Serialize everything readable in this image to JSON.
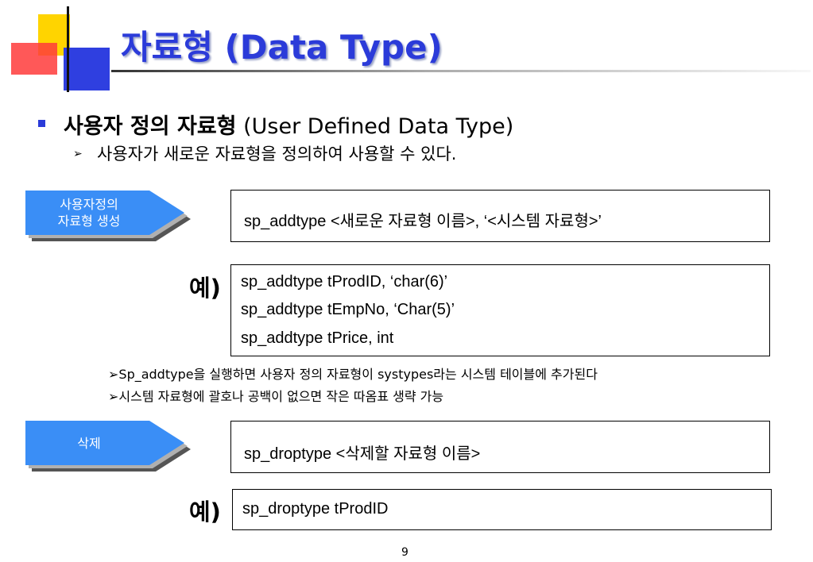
{
  "slide": {
    "title": "자료형 (Data Type)",
    "page_number": "9",
    "bullet1": {
      "kor": "사용자 정의 자료형",
      "eng": "(User Defined Data Type)"
    },
    "bullet2": {
      "marker": "➢",
      "text": "사용자가 새로운 자료형을 정의하여 사용할 수 있다."
    },
    "create_section": {
      "label_line1": "사용자정의",
      "label_line2": "자료형 생성",
      "syntax": "sp_addtype  <새로운 자료형 이름>, ‘<시스템 자료형>’",
      "example_label": "예)",
      "examples": [
        "sp_addtype tProdID, ‘char(6)’",
        "sp_addtype tEmpNo, ‘Char(5)’",
        "sp_addtype tPrice, int"
      ],
      "notes": [
        "➢Sp_addtype을 실행하면 사용자 정의 자료형이 systypes라는 시스템 테이블에 추가된다",
        "➢시스템 자료형에 괄호나 공백이 없으면 작은 따옴표 생략 가능"
      ]
    },
    "drop_section": {
      "label": "삭제",
      "syntax": "sp_droptype  <삭제할 자료형 이름>",
      "example_label": "예)",
      "example": "sp_droptype tProdID"
    },
    "colors": {
      "title": "#2b3bd9",
      "arrow": "#3a8ef6",
      "yellow": "#ffd400",
      "red": "#ff3b3b",
      "blue": "#2f3fe0"
    }
  }
}
